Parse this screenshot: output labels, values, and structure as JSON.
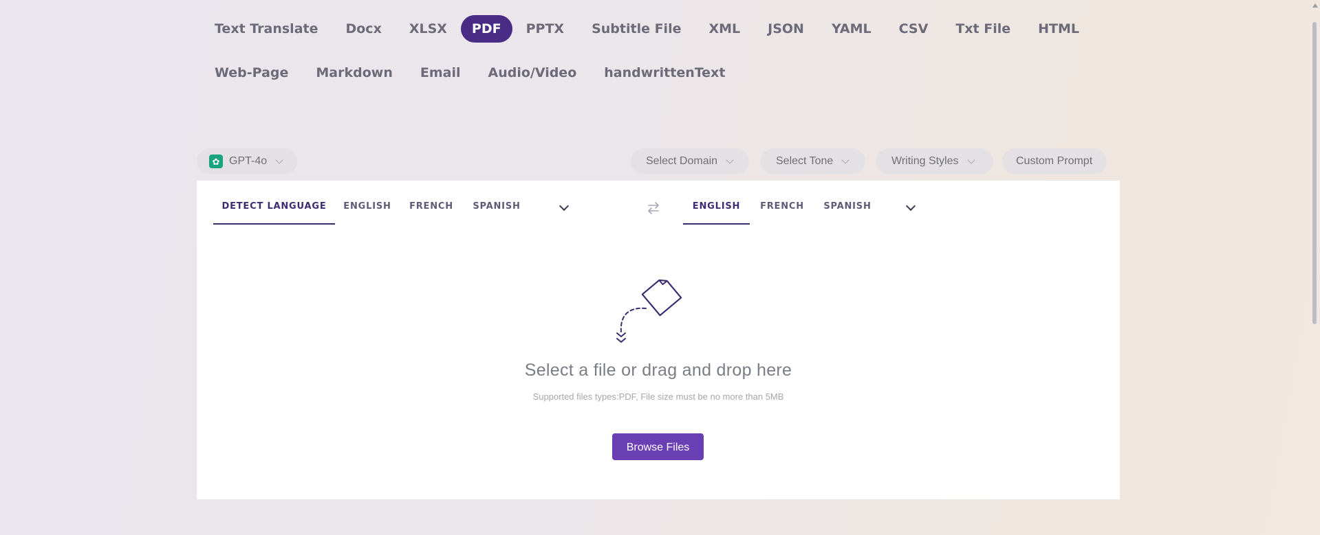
{
  "file_types": {
    "row1": [
      {
        "label": "Text Translate",
        "active": false
      },
      {
        "label": "Docx",
        "active": false
      },
      {
        "label": "XLSX",
        "active": false
      },
      {
        "label": "PDF",
        "active": true
      },
      {
        "label": "PPTX",
        "active": false
      },
      {
        "label": "Subtitle File",
        "active": false
      },
      {
        "label": "XML",
        "active": false
      },
      {
        "label": "JSON",
        "active": false
      },
      {
        "label": "YAML",
        "active": false
      },
      {
        "label": "CSV",
        "active": false
      },
      {
        "label": "Txt File",
        "active": false
      },
      {
        "label": "HTML",
        "active": false
      }
    ],
    "row2": [
      {
        "label": "Web-Page",
        "active": false
      },
      {
        "label": "Markdown",
        "active": false
      },
      {
        "label": "Email",
        "active": false
      },
      {
        "label": "Audio/Video",
        "active": false
      },
      {
        "label": "handwrittenText",
        "active": false
      }
    ]
  },
  "options": {
    "model": "GPT-4o",
    "model_icon": "openai-icon",
    "domain": "Select Domain",
    "tone": "Select Tone",
    "writing_styles": "Writing Styles",
    "custom_prompt": "Custom Prompt"
  },
  "source_languages": {
    "items": [
      "DETECT LANGUAGE",
      "ENGLISH",
      "FRENCH",
      "SPANISH"
    ],
    "active": "DETECT LANGUAGE"
  },
  "target_languages": {
    "items": [
      "ENGLISH",
      "FRENCH",
      "SPANISH"
    ],
    "active": "ENGLISH"
  },
  "dropzone": {
    "title": "Select a file or drag and drop here",
    "subtitle": "Supported files types:PDF, File size must be no more than 5MB",
    "button": "Browse Files"
  },
  "colors": {
    "accent": "#4a2c86",
    "button": "#6a3fb4",
    "model_icon": "#19a37e"
  }
}
